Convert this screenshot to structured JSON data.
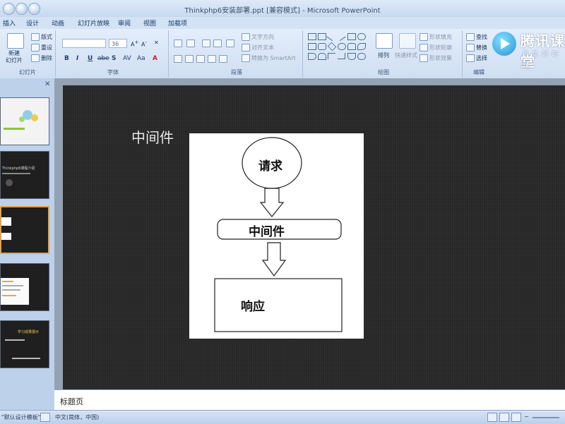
{
  "window": {
    "title": "Thinkphp6安装部署.ppt [兼容模式] - Microsoft PowerPoint"
  },
  "ribbon_tabs": [
    "插入",
    "设计",
    "动画",
    "幻灯片放映",
    "审阅",
    "视图",
    "加载项"
  ],
  "ribbon": {
    "slides": {
      "new_slide_label": "新建\n幻灯片",
      "layout": "版式",
      "reset": "重设",
      "delete": "删除",
      "group": "幻灯片"
    },
    "font": {
      "font_size": "36",
      "bold": "B",
      "italic": "I",
      "underline": "U",
      "strike": "abe",
      "shadow": "S",
      "spacing": "AV",
      "case": "Aa",
      "color": "A",
      "group": "字体"
    },
    "paragraph": {
      "text_direction": "文字方向",
      "align_text": "对齐文本",
      "smartart": "转换为 SmartArt",
      "group": "段落"
    },
    "drawing": {
      "arrange": "排列",
      "quick_styles": "快速样式",
      "shape_fill": "形状填充",
      "shape_outline": "形状轮廓",
      "shape_effects": "形状效果",
      "group": "绘图"
    },
    "editing": {
      "find": "查找",
      "replace": "替换",
      "select": "选择",
      "group": "编辑"
    }
  },
  "watermark": {
    "name": "腾讯课堂",
    "sub": "不负好时光"
  },
  "thumbnails": [
    {
      "index": 1,
      "selected": false,
      "text": ""
    },
    {
      "index": 2,
      "selected": false,
      "text": "Thinkphp6课程介绍"
    },
    {
      "index": 3,
      "selected": true,
      "text": ""
    },
    {
      "index": 4,
      "selected": false,
      "text": ""
    },
    {
      "index": 5,
      "selected": false,
      "text": "学习成果展示"
    }
  ],
  "slide": {
    "title": "中间件",
    "diagram": {
      "request": "请求",
      "middleware": "中间件",
      "response": "响应"
    }
  },
  "notes": {
    "text": "标题页"
  },
  "status": {
    "theme": "\"默认设计模板\"",
    "language": "中文(简体，中国)"
  },
  "colors": {
    "slide_bg": "#262626",
    "ribbon_bg": "#dce8f7",
    "selected_thumb_border": "#e3a14b"
  }
}
